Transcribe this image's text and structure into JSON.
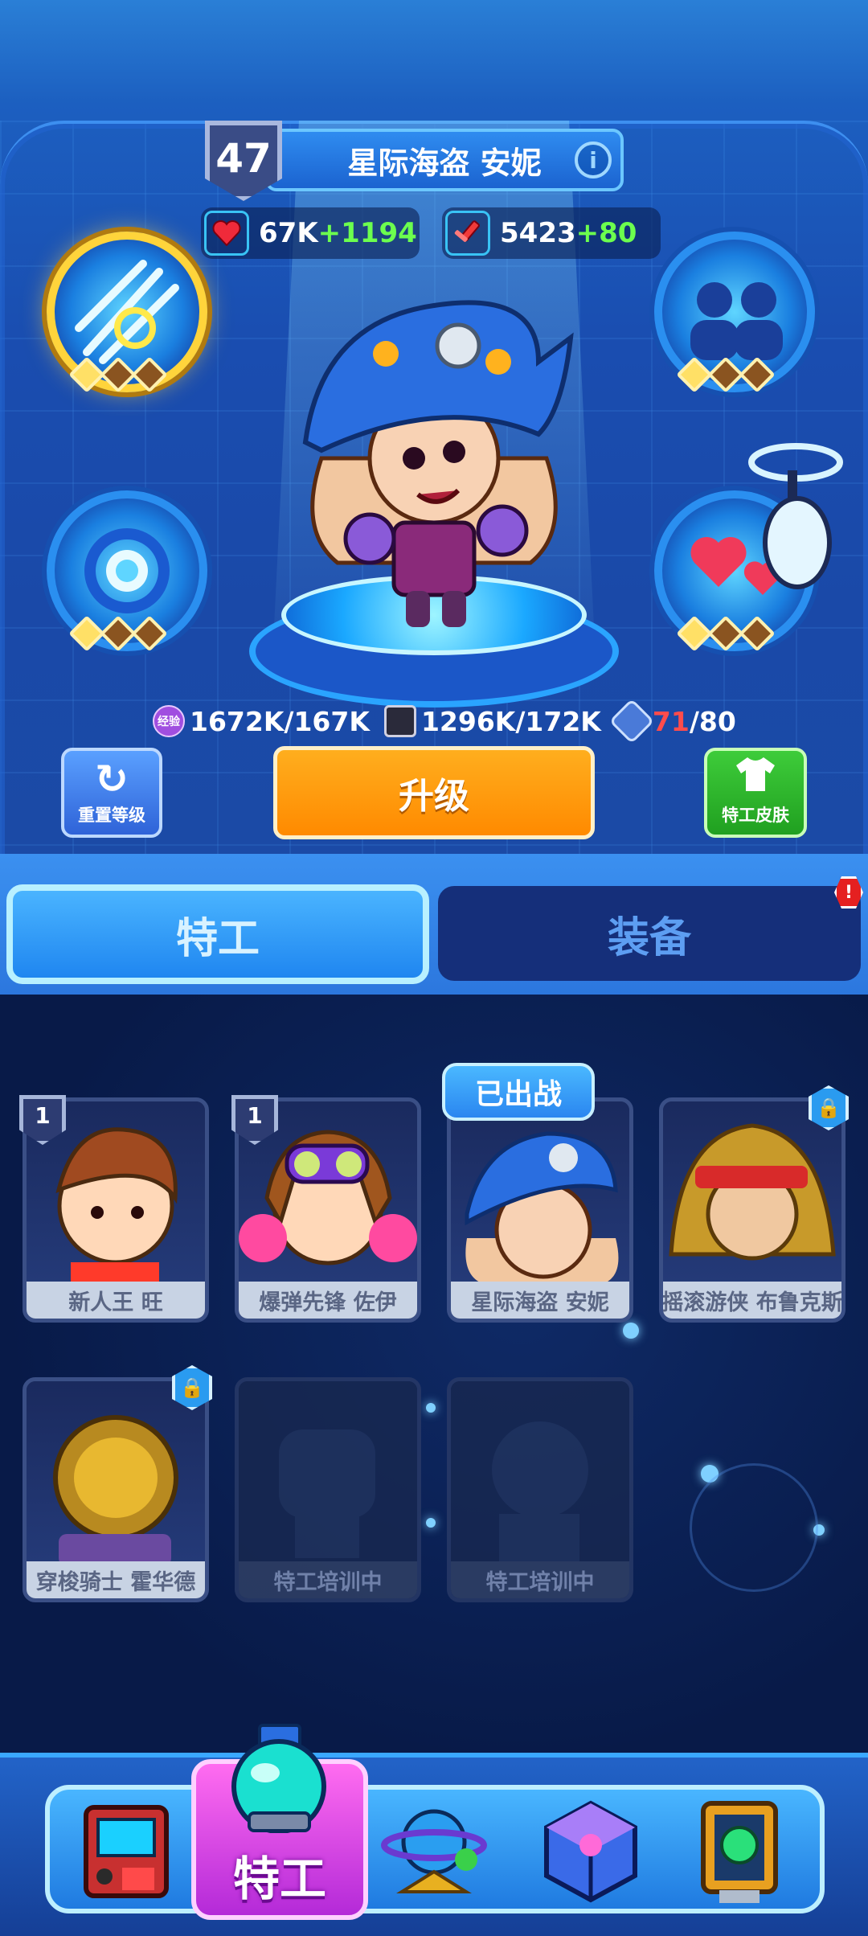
{
  "agent": {
    "level": "47",
    "name": "星际海盗 安妮",
    "hp": {
      "value": "67K",
      "bonus": "+1194"
    },
    "attack": {
      "value": "5423",
      "bonus": "+80"
    }
  },
  "resources": {
    "exp": {
      "icon_text": "经验",
      "value": "1672K/167K"
    },
    "tape": {
      "value": "1296K/172K"
    },
    "chips": {
      "current": "71",
      "max": "/80"
    }
  },
  "buttons": {
    "reset_label": "重置等级",
    "upgrade_label": "升级",
    "skin_label": "特工皮肤"
  },
  "tabs": {
    "agent": "特工",
    "equipment": "装备",
    "equipment_alert": "!"
  },
  "deployed_tag": "已出战",
  "agents": [
    {
      "name": "新人王 旺",
      "level": "1"
    },
    {
      "name": "爆弹先锋 佐伊",
      "level": "1"
    },
    {
      "name": "星际海盗 安妮"
    },
    {
      "name": "摇滚游侠 布鲁克斯"
    },
    {
      "name": "穿梭骑士 霍华德"
    },
    {
      "name": "特工培训中"
    },
    {
      "name": "特工培训中"
    }
  ],
  "nav": {
    "active_label": "特工"
  },
  "colors": {
    "accent_blue": "#2a8ff0",
    "upgrade_orange": "#ff9a00",
    "skin_green": "#2fb82c",
    "bonus_green": "#6cff4e",
    "active_nav_magenta": "#c23ee0",
    "alert_red": "#e52020"
  },
  "icons": {
    "hp": "heart-icon",
    "attack": "sword-icon",
    "reset": "refresh-icon",
    "skin": "shirt-icon",
    "info": "info-icon",
    "lock": "lock-icon"
  }
}
